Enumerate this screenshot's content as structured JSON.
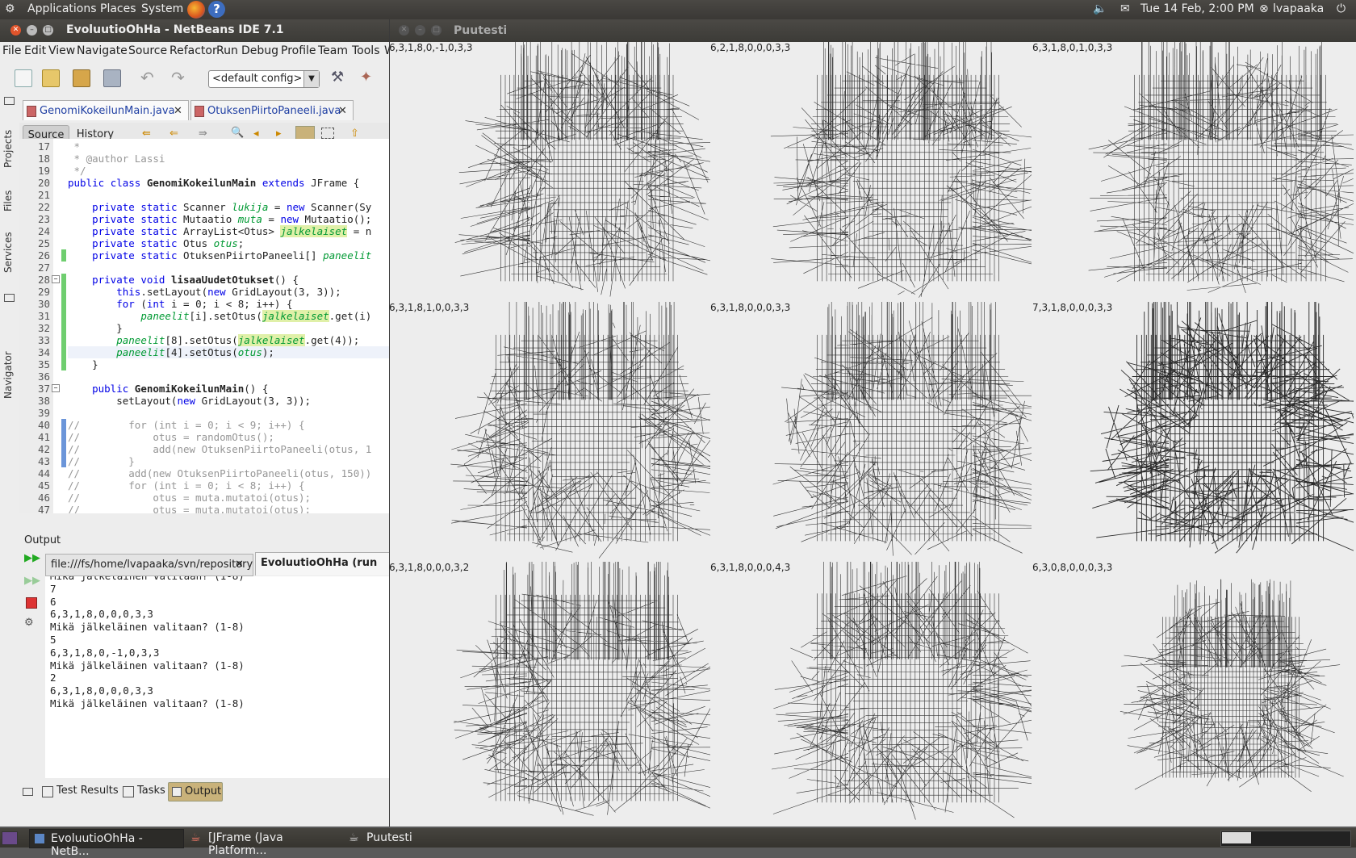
{
  "top_panel": {
    "menu": [
      "Applications",
      "Places",
      "System"
    ],
    "clock": "Tue 14 Feb,  2:00 PM",
    "user": "lvapaaka"
  },
  "netbeans": {
    "title": "EvoluutioOhHa - NetBeans IDE 7.1",
    "menu": [
      "File",
      "Edit",
      "View",
      "Navigate",
      "Source",
      "Refactor",
      "Run",
      "Debug",
      "Profile",
      "Team",
      "Tools",
      "W"
    ],
    "config_value": "<default config>",
    "side_tabs": [
      "Projects",
      "Files",
      "Services",
      "Navigator"
    ],
    "editor_tabs": [
      {
        "label": "GenomiKokeilunMain.java",
        "active": true
      },
      {
        "label": "OtuksenPiirtoPaneeli.java",
        "active": false
      }
    ],
    "source_tab": "Source",
    "history_tab": "History",
    "code_lines": [
      {
        "n": "17",
        "t": " *"
      },
      {
        "n": "18",
        "t": " * @author Lassi"
      },
      {
        "n": "19",
        "t": " */"
      },
      {
        "n": "20",
        "t": "public class GenomiKokeilunMain extends JFrame {"
      },
      {
        "n": "21",
        "t": ""
      },
      {
        "n": "22",
        "t": "    private static Scanner lukija = new Scanner(Sy"
      },
      {
        "n": "23",
        "t": "    private static Mutaatio muta = new Mutaatio();"
      },
      {
        "n": "24",
        "t": "    private static ArrayList<Otus> jalkelaiset = n"
      },
      {
        "n": "25",
        "t": "    private static Otus otus;"
      },
      {
        "n": "26",
        "t": "    private static OtuksenPiirtoPaneeli[] paneelit"
      },
      {
        "n": "27",
        "t": ""
      },
      {
        "n": "28",
        "t": "    private void lisaaUudetOtukset() {"
      },
      {
        "n": "29",
        "t": "        this.setLayout(new GridLayout(3, 3));"
      },
      {
        "n": "30",
        "t": "        for (int i = 0; i < 8; i++) {"
      },
      {
        "n": "31",
        "t": "            paneelit[i].setOtus(jalkelaiset.get(i)"
      },
      {
        "n": "32",
        "t": "        }"
      },
      {
        "n": "33",
        "t": "        paneelit[8].setOtus(jalkelaiset.get(4));"
      },
      {
        "n": "34",
        "t": "        paneelit[4].setOtus(otus);"
      },
      {
        "n": "35",
        "t": "    }"
      },
      {
        "n": "36",
        "t": ""
      },
      {
        "n": "37",
        "t": "    public GenomiKokeilunMain() {"
      },
      {
        "n": "38",
        "t": "        setLayout(new GridLayout(3, 3));"
      },
      {
        "n": "39",
        "t": ""
      },
      {
        "n": "40",
        "t": "//        for (int i = 0; i < 9; i++) {"
      },
      {
        "n": "41",
        "t": "//            otus = randomOtus();"
      },
      {
        "n": "42",
        "t": "//            add(new OtuksenPiirtoPaneeli(otus, 1"
      },
      {
        "n": "43",
        "t": "//        }"
      },
      {
        "n": "44",
        "t": "//        add(new OtuksenPiirtoPaneeli(otus, 150))"
      },
      {
        "n": "45",
        "t": "//        for (int i = 0; i < 8; i++) {"
      },
      {
        "n": "46",
        "t": "//            otus = muta.mutatoi(otus);"
      },
      {
        "n": "47",
        "t": "//            otus = muta.mutatoi(otus);"
      },
      {
        "n": "48",
        "t": "//            otus = muta.mutatoi(otus);"
      }
    ],
    "output_label": "Output",
    "output_tabs": [
      {
        "label": "file:///fs/home/lvapaaka/svn/repository"
      },
      {
        "label": "EvoluutioOhHa (run"
      }
    ],
    "output_lines": [
      "Mikä jälkeläinen valitaan? (1-8)",
      "7",
      "6",
      "6,3,1,8,0,0,0,3,3",
      "Mikä jälkeläinen valitaan? (1-8)",
      "5",
      "6,3,1,8,0,-1,0,3,3",
      "Mikä jälkeläinen valitaan? (1-8)",
      "2",
      "6,3,1,8,0,0,0,3,3",
      "Mikä jälkeläinen valitaan? (1-8)"
    ],
    "bottom_tabs": [
      "Test Results",
      "Tasks",
      "Output"
    ]
  },
  "puutesti": {
    "title": "Puutesti",
    "genomes": [
      "6,3,1,8,0,-1,0,3,3",
      "6,2,1,8,0,0,0,3,3",
      "6,3,1,8,0,1,0,3,3",
      "6,3,1,8,1,0,0,3,3",
      "6,3,1,8,0,0,0,3,3",
      "7,3,1,8,0,0,0,3,3",
      "6,3,1,8,0,0,0,3,2",
      "6,3,1,8,0,0,0,4,3",
      "6,3,0,8,0,0,0,3,3"
    ]
  },
  "taskbar": {
    "items": [
      "EvoluutioOhHa - NetB...",
      "[JFrame (Java Platform...",
      "Puutesti"
    ]
  }
}
